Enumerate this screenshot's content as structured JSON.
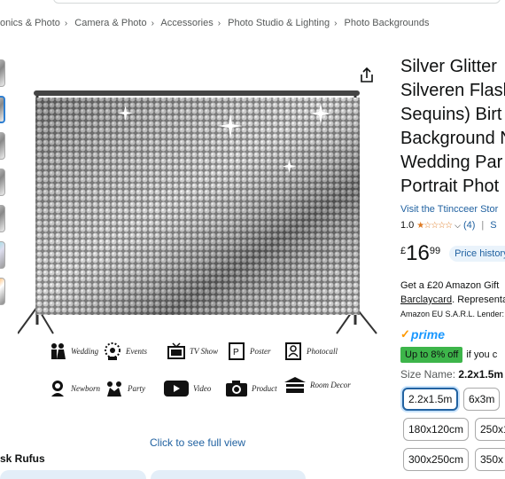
{
  "breadcrumb": [
    "onics & Photo",
    "Camera & Photo",
    "Accessories",
    "Photo Studio & Lighting",
    "Photo Backgrounds"
  ],
  "product": {
    "title_lines": [
      "Silver Glitter",
      "Silveren Flash",
      "Sequins) Birt",
      "Background N",
      "Wedding Par",
      "Portrait Phot"
    ],
    "store_link": "Visit the Ttincceer Stor",
    "rating": "1.0",
    "rating_count": "(4)",
    "rating_after": "S",
    "price_currency": "£",
    "price_whole": "16",
    "price_fraction": "99",
    "price_history": "Price history",
    "gift_line": "Get a £20 Amazon Gift",
    "barclay_link": "Barclaycard",
    "barclay_rest": ". Representa",
    "lender": "Amazon EU S.A.R.L. Lender:",
    "prime_label": "prime",
    "upto_badge": "Up to 8% off",
    "upto_rest": "if you c",
    "size_label": "Size Name:",
    "size_value": "2.2x1.5m",
    "sizes": [
      "2.2x1.5m",
      "6x3m",
      "180x120cm",
      "250x1",
      "300x250cm",
      "350x"
    ]
  },
  "image_icons": [
    "Wedding",
    "Events",
    "TV Show",
    "Poster",
    "Photocall",
    "Newborn",
    "Party",
    "Video",
    "Product",
    "Room Decor"
  ],
  "see_full_view": "Click to see full view",
  "ask_rufus": "sk Rufus",
  "colors": {
    "link": "#2162a1",
    "star": "#de7921",
    "prime": "#1a98ff",
    "deal": "#3db54a"
  }
}
